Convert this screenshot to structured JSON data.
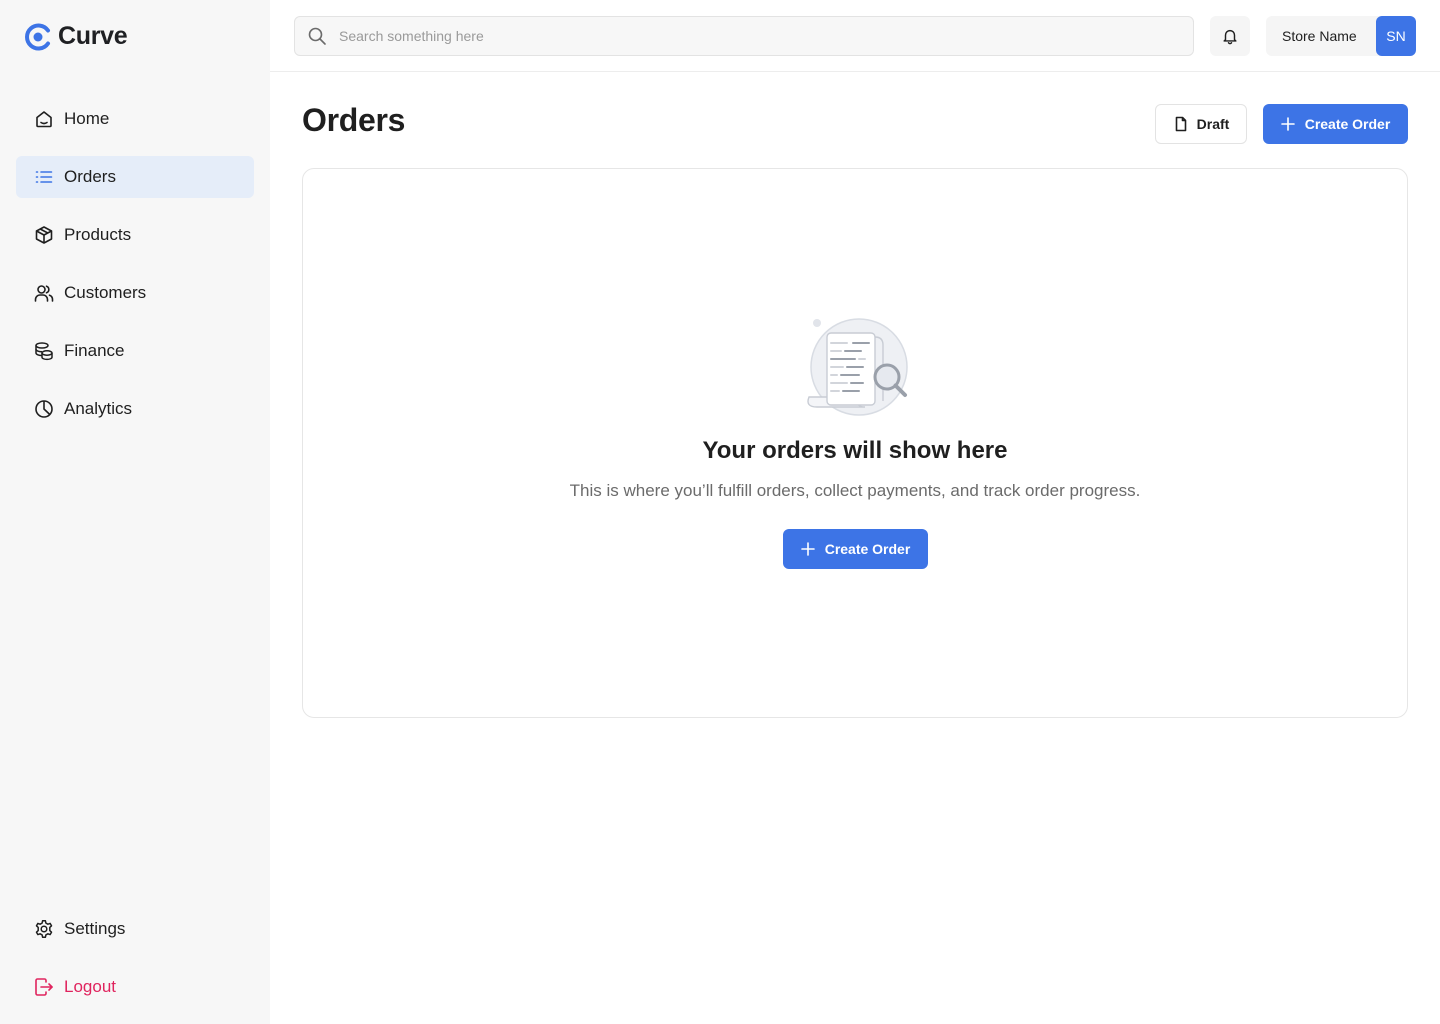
{
  "brand": {
    "name": "Curve",
    "accent": "#3d74e6"
  },
  "sidebar": {
    "items": [
      {
        "label": "Home",
        "icon": "home-icon"
      },
      {
        "label": "Orders",
        "icon": "list-icon",
        "active": true
      },
      {
        "label": "Products",
        "icon": "box-icon"
      },
      {
        "label": "Customers",
        "icon": "users-icon"
      },
      {
        "label": "Finance",
        "icon": "coins-icon"
      },
      {
        "label": "Analytics",
        "icon": "pie-chart-icon"
      }
    ],
    "settings_label": "Settings",
    "logout_label": "Logout",
    "logout_color": "#e0245e"
  },
  "topbar": {
    "search_placeholder": "Search something here",
    "store_name": "Store Name",
    "avatar_initials": "SN"
  },
  "main": {
    "title": "Orders",
    "draft_label": "Draft",
    "create_label": "Create Order",
    "empty": {
      "title": "Your orders will show here",
      "description": "This is where you’ll fulfill orders, collect payments, and track order progress.",
      "button_label": "Create Order"
    }
  }
}
